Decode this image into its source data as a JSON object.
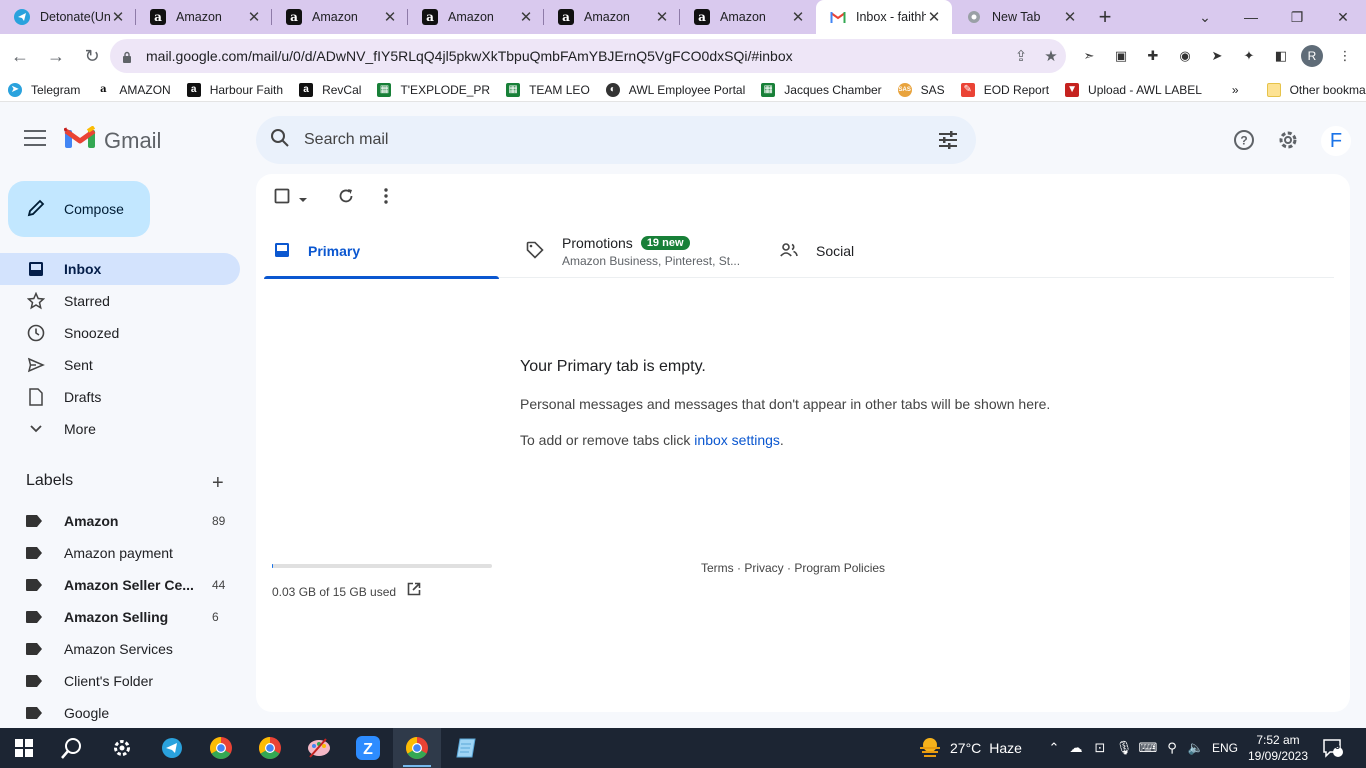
{
  "browser": {
    "tabs": [
      {
        "title": "Detonate(Unc",
        "favicon": "telegram-icon"
      },
      {
        "title": "Amazon",
        "favicon": "amazon-icon"
      },
      {
        "title": "Amazon",
        "favicon": "amazon-icon"
      },
      {
        "title": "Amazon",
        "favicon": "amazon-icon"
      },
      {
        "title": "Amazon",
        "favicon": "amazon-icon"
      },
      {
        "title": "Amazon",
        "favicon": "amazon-icon"
      },
      {
        "title": "Inbox - faithh",
        "favicon": "gmail-icon",
        "active": true
      },
      {
        "title": "New Tab",
        "favicon": "chrome-icon"
      }
    ],
    "url": "mail.google.com/mail/u/0/d/ADwNV_fIY5RLqQ4jl5pkwXkTbpuQmbFAmYBJErnQ5VgFCO0dxSQi/#inbox",
    "profile_initial": "R",
    "bookmarks": [
      {
        "label": "Telegram",
        "icon": "telegram-icon",
        "color": "#2aa2dd"
      },
      {
        "label": "AMAZON",
        "icon": "amazon-icon",
        "color": "#ffffff"
      },
      {
        "label": "Harbour Faith",
        "icon": "amazon-icon",
        "color": "#111111"
      },
      {
        "label": "RevCal",
        "icon": "amazon-icon",
        "color": "#111111"
      },
      {
        "label": "T'EXPLODE_PR",
        "icon": "sheets-icon",
        "color": "#188038"
      },
      {
        "label": "TEAM LEO",
        "icon": "sheets-icon",
        "color": "#188038"
      },
      {
        "label": "AWL Employee Portal",
        "icon": "globe-icon",
        "color": "#333333"
      },
      {
        "label": "Jacques Chamber",
        "icon": "sheets-icon",
        "color": "#188038"
      },
      {
        "label": "SAS",
        "icon": "sas-icon",
        "color": "#e8a33d"
      },
      {
        "label": "EOD Report",
        "icon": "eod-icon",
        "color": "#ea4335"
      },
      {
        "label": "Upload - AWL LABEL",
        "icon": "upload-icon",
        "color": "#c5221f"
      }
    ],
    "bookmarks_more": "»",
    "other_bookmarks": "Other bookmarks"
  },
  "gmail": {
    "brand": "Gmail",
    "search_placeholder": "Search mail",
    "account_initial": "F",
    "compose": "Compose",
    "nav": [
      {
        "label": "Inbox",
        "icon": "inbox-icon",
        "active": true
      },
      {
        "label": "Starred",
        "icon": "star-icon"
      },
      {
        "label": "Snoozed",
        "icon": "clock-icon"
      },
      {
        "label": "Sent",
        "icon": "send-icon"
      },
      {
        "label": "Drafts",
        "icon": "draft-icon"
      },
      {
        "label": "More",
        "icon": "chevron-down-icon"
      }
    ],
    "labels_title": "Labels",
    "labels": [
      {
        "name": "Amazon",
        "count": "89",
        "bold": true
      },
      {
        "name": "Amazon payment",
        "count": "",
        "bold": false
      },
      {
        "name": "Amazon Seller Ce...",
        "count": "44",
        "bold": true
      },
      {
        "name": "Amazon Selling",
        "count": "6",
        "bold": true
      },
      {
        "name": "Amazon Services",
        "count": "",
        "bold": false
      },
      {
        "name": "Client's Folder",
        "count": "",
        "bold": false
      },
      {
        "name": "Google",
        "count": "",
        "bold": false
      }
    ],
    "tabs": {
      "primary": "Primary",
      "promotions": "Promotions",
      "promotions_badge": "19 new",
      "promotions_sub": "Amazon Business, Pinterest, St...",
      "social": "Social"
    },
    "empty": {
      "title": "Your Primary tab is empty.",
      "line1": "Personal messages and messages that don't appear in other tabs will be shown here.",
      "line2_prefix": "To add or remove tabs click ",
      "line2_link": "inbox settings",
      "line2_suffix": "."
    },
    "storage": {
      "text": "0.03 GB of 15 GB used",
      "fraction": 0.002
    },
    "footer": {
      "terms": "Terms",
      "sep": " · ",
      "privacy": "Privacy",
      "policies": "Program Policies"
    }
  },
  "taskbar": {
    "weather_temp": "27°C",
    "weather_cond": "Haze",
    "lang": "ENG",
    "time": "7:52 am",
    "date": "19/09/2023",
    "notif_count": "5"
  }
}
